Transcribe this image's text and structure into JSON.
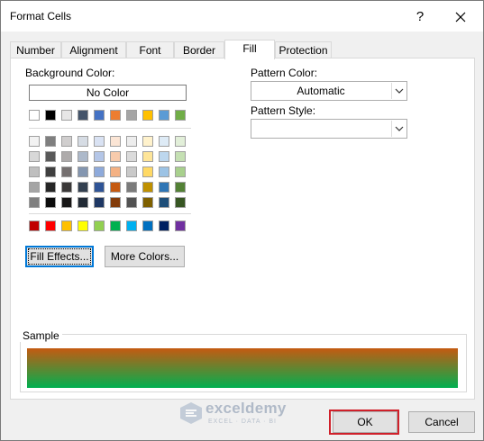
{
  "window": {
    "title": "Format Cells",
    "help_glyph": "?"
  },
  "tabs": [
    {
      "label": "Number"
    },
    {
      "label": "Alignment"
    },
    {
      "label": "Font"
    },
    {
      "label": "Border"
    },
    {
      "label": "Fill"
    },
    {
      "label": "Protection"
    }
  ],
  "active_tab": "Fill",
  "fill": {
    "background_color_label": "Background Color:",
    "no_color_label": "No Color",
    "fill_effects_label": "Fill Effects...",
    "more_colors_label": "More Colors...",
    "pattern_color_label": "Pattern Color:",
    "pattern_color_value": "Automatic",
    "pattern_style_label": "Pattern Style:",
    "pattern_style_value": "",
    "sample_label": "Sample",
    "sample_gradient": {
      "top_color": "#c55a11",
      "bottom_color": "#00b050"
    }
  },
  "palette": {
    "theme_top_row": [
      "#ffffff",
      "#000000",
      "#e7e6e6",
      "#44546a",
      "#4472c4",
      "#ed7d31",
      "#a5a5a5",
      "#ffc000",
      "#5b9bd5",
      "#70ad47"
    ],
    "theme_shades": [
      [
        "#f2f2f2",
        "#7f7f7f",
        "#d0cece",
        "#d6dce4",
        "#d9e2f3",
        "#fbe5d5",
        "#ededed",
        "#fff2cc",
        "#deebf6",
        "#e2efd9"
      ],
      [
        "#d8d8d8",
        "#595959",
        "#aeabab",
        "#adb9ca",
        "#b4c6e7",
        "#f7cbac",
        "#dbdbdb",
        "#fee599",
        "#bdd7ee",
        "#c5e0b3"
      ],
      [
        "#bfbfbf",
        "#3f3f3f",
        "#757070",
        "#8496b0",
        "#8eaadb",
        "#f4b183",
        "#c9c9c9",
        "#ffd965",
        "#9cc3e5",
        "#a8d08d"
      ],
      [
        "#a5a5a5",
        "#262626",
        "#3a3838",
        "#323f4f",
        "#2f5496",
        "#c55a11",
        "#7b7b7b",
        "#bf9000",
        "#2e75b5",
        "#538135"
      ],
      [
        "#7f7f7f",
        "#0c0c0c",
        "#171616",
        "#222a35",
        "#1f3864",
        "#833c0b",
        "#525252",
        "#7f6000",
        "#1e4e79",
        "#375623"
      ]
    ],
    "standard_colors": [
      "#c00000",
      "#ff0000",
      "#ffc000",
      "#ffff00",
      "#92d050",
      "#00b050",
      "#00b0f0",
      "#0070c0",
      "#002060",
      "#7030a0"
    ]
  },
  "buttons": {
    "ok_label": "OK",
    "cancel_label": "Cancel"
  },
  "watermark": {
    "name": "exceldemy",
    "tagline": "EXCEL · DATA · BI"
  }
}
